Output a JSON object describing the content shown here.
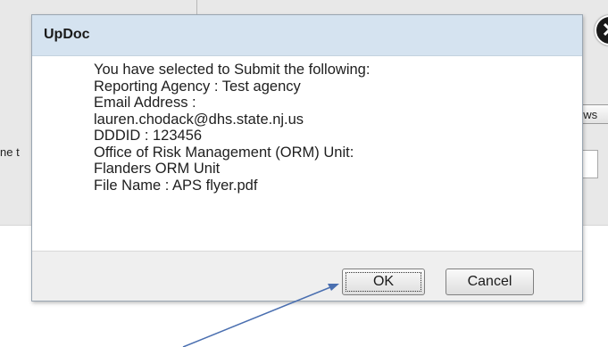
{
  "background": {
    "browse_button_partial": "Brows",
    "label_partial": "ne t"
  },
  "dialog": {
    "title": "UpDoc",
    "close_glyph": "✕",
    "message_lines": [
      "You have selected to Submit the following:",
      "Reporting Agency : Test agency",
      "Email Address :",
      "lauren.chodack@dhs.state.nj.us",
      "DDDID : 123456",
      "Office of Risk Management (ORM) Unit:",
      "Flanders ORM Unit",
      "File Name : APS flyer.pdf"
    ],
    "ok_label": "OK",
    "cancel_label": "Cancel"
  },
  "colors": {
    "titlebar": "#d5e3f0",
    "annotation_arrow": "#4a6fb0"
  },
  "icons": {
    "close": "close-icon",
    "annotation": "arrow-annotation"
  }
}
